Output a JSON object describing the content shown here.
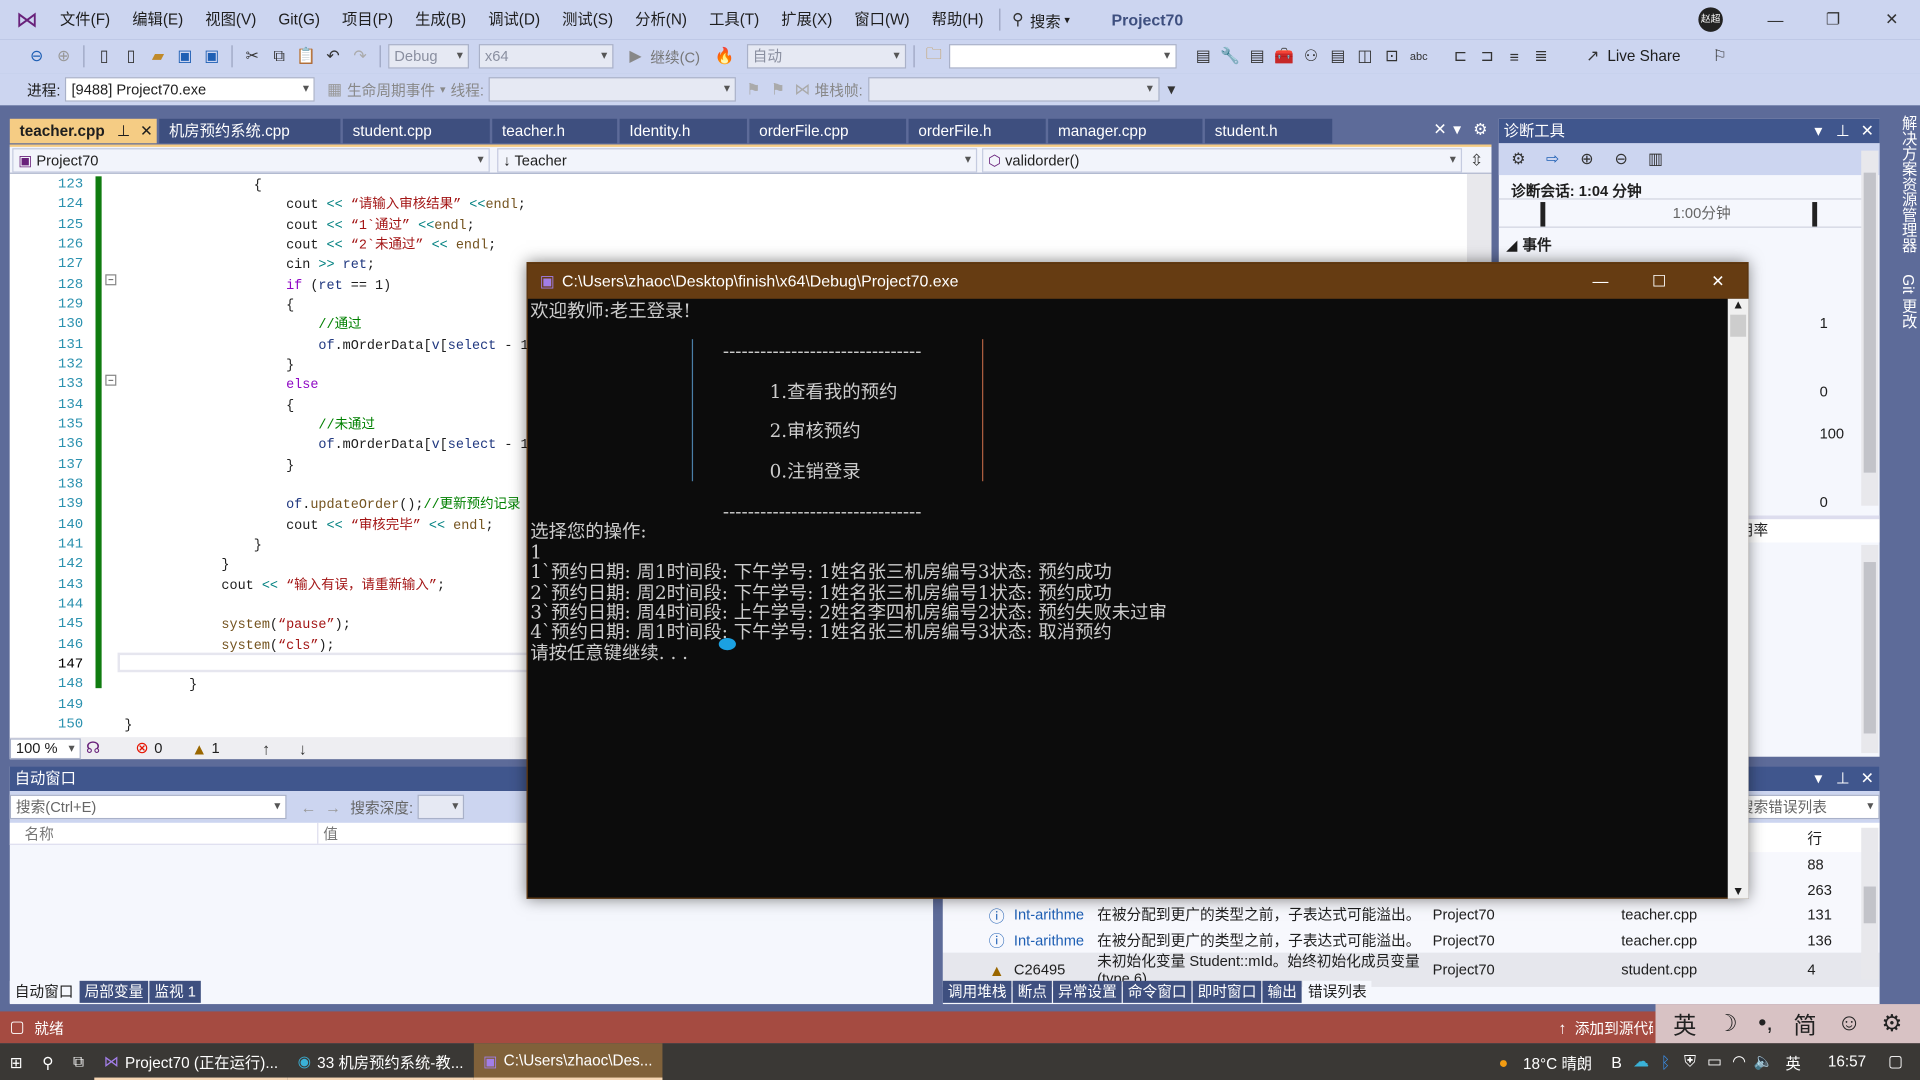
{
  "menubar": {
    "items": [
      "文件(F)",
      "编辑(E)",
      "视图(V)",
      "Git(G)",
      "项目(P)",
      "生成(B)",
      "调试(D)",
      "测试(S)",
      "分析(N)",
      "工具(T)",
      "扩展(X)",
      "窗口(W)",
      "帮助(H)"
    ],
    "search": "搜索",
    "project_title": "Project70",
    "avatar": "赵超"
  },
  "toolbar": {
    "config": "Debug",
    "platform": "x64",
    "continue": "继续(C)",
    "auto": "自动",
    "live_share": "Live Share"
  },
  "debugbar": {
    "process_label": "进程:",
    "process": "[9488] Project70.exe",
    "lifecycle": "生命周期事件",
    "thread_label": "线程:",
    "stack_label": "堆栈帧:"
  },
  "tabs": [
    "teacher.cpp",
    "机房预约系统.cpp",
    "student.cpp",
    "teacher.h",
    "Identity.h",
    "orderFile.cpp",
    "orderFile.h",
    "manager.cpp",
    "student.h"
  ],
  "nav": {
    "project": "Project70",
    "class": "Teacher",
    "member": "validorder()"
  },
  "code": [
    {
      "n": "123",
      "t": [
        [
          "                 {",
          "pl"
        ]
      ]
    },
    {
      "n": "124",
      "t": [
        [
          "                     cout ",
          "pl"
        ],
        [
          "<<",
          "op"
        ],
        [
          " “请输入审核结果” ",
          "str"
        ],
        [
          "<<",
          "op"
        ],
        [
          "endl",
          "fn"
        ],
        [
          ";",
          "pl"
        ]
      ]
    },
    {
      "n": "125",
      "t": [
        [
          "                     cout ",
          "pl"
        ],
        [
          "<<",
          "op"
        ],
        [
          " “1`通过” ",
          "str"
        ],
        [
          "<<",
          "op"
        ],
        [
          "endl",
          "fn"
        ],
        [
          ";",
          "pl"
        ]
      ]
    },
    {
      "n": "126",
      "t": [
        [
          "                     cout ",
          "pl"
        ],
        [
          "<<",
          "op"
        ],
        [
          " “2`未通过” ",
          "str"
        ],
        [
          "<<",
          "op"
        ],
        [
          " endl",
          "fn"
        ],
        [
          ";",
          "pl"
        ]
      ]
    },
    {
      "n": "127",
      "t": [
        [
          "                     cin ",
          "pl"
        ],
        [
          ">>",
          "op"
        ],
        [
          " ret",
          "id"
        ],
        [
          ";",
          "pl"
        ]
      ]
    },
    {
      "n": "128",
      "t": [
        [
          "                     ",
          "pl"
        ],
        [
          "if",
          "kw"
        ],
        [
          " (",
          "pl"
        ],
        [
          "ret",
          "id"
        ],
        [
          " == 1)",
          "pl"
        ]
      ]
    },
    {
      "n": "129",
      "t": [
        [
          "                     {",
          "pl"
        ]
      ]
    },
    {
      "n": "130",
      "t": [
        [
          "                         //通过",
          "cm"
        ]
      ]
    },
    {
      "n": "131",
      "t": [
        [
          "                         ",
          "pl"
        ],
        [
          "of",
          "id"
        ],
        [
          ".mOrderData[",
          "pl"
        ],
        [
          "v",
          "id"
        ],
        [
          "[",
          "pl"
        ],
        [
          "select",
          "id"
        ],
        [
          " - 1]][\"s",
          "pl"
        ]
      ]
    },
    {
      "n": "132",
      "t": [
        [
          "                     }",
          "pl"
        ]
      ]
    },
    {
      "n": "133",
      "t": [
        [
          "                     ",
          "pl"
        ],
        [
          "else",
          "kw"
        ]
      ]
    },
    {
      "n": "134",
      "t": [
        [
          "                     {",
          "pl"
        ]
      ]
    },
    {
      "n": "135",
      "t": [
        [
          "                         //未通过",
          "cm"
        ]
      ]
    },
    {
      "n": "136",
      "t": [
        [
          "                         ",
          "pl"
        ],
        [
          "of",
          "id"
        ],
        [
          ".mOrderData[",
          "pl"
        ],
        [
          "v",
          "id"
        ],
        [
          "[",
          "pl"
        ],
        [
          "select",
          "id"
        ],
        [
          " - 1]][\"s",
          "pl"
        ]
      ]
    },
    {
      "n": "137",
      "t": [
        [
          "                     }",
          "pl"
        ]
      ]
    },
    {
      "n": "138",
      "t": [
        [
          "",
          "pl"
        ]
      ]
    },
    {
      "n": "139",
      "t": [
        [
          "                     ",
          "pl"
        ],
        [
          "of",
          "id"
        ],
        [
          ".",
          "pl"
        ],
        [
          "updateOrder",
          "fn"
        ],
        [
          "();",
          "pl"
        ],
        [
          "//更新预约记录",
          "cm"
        ]
      ]
    },
    {
      "n": "140",
      "t": [
        [
          "                     cout ",
          "pl"
        ],
        [
          "<<",
          "op"
        ],
        [
          " “审核完毕” ",
          "str"
        ],
        [
          "<<",
          "op"
        ],
        [
          " endl",
          "fn"
        ],
        [
          ";",
          "pl"
        ]
      ]
    },
    {
      "n": "141",
      "t": [
        [
          "                 }",
          "pl"
        ]
      ]
    },
    {
      "n": "142",
      "t": [
        [
          "             }",
          "pl"
        ]
      ]
    },
    {
      "n": "143",
      "t": [
        [
          "             cout ",
          "pl"
        ],
        [
          "<<",
          "op"
        ],
        [
          " “输入有误，请重新输入”",
          "str"
        ],
        [
          ";",
          "pl"
        ]
      ]
    },
    {
      "n": "144",
      "t": [
        [
          "",
          "pl"
        ]
      ]
    },
    {
      "n": "145",
      "t": [
        [
          "             ",
          "pl"
        ],
        [
          "system",
          "fn"
        ],
        [
          "(",
          "pl"
        ],
        [
          "“pause”",
          "str"
        ],
        [
          ");",
          "pl"
        ]
      ]
    },
    {
      "n": "146",
      "t": [
        [
          "             ",
          "pl"
        ],
        [
          "system",
          "fn"
        ],
        [
          "(",
          "pl"
        ],
        [
          "“cls”",
          "str"
        ],
        [
          ");",
          "pl"
        ]
      ]
    },
    {
      "n": "147",
      "t": [
        [
          "",
          "pl"
        ]
      ]
    },
    {
      "n": "148",
      "t": [
        [
          "         }",
          "pl"
        ]
      ]
    },
    {
      "n": "149",
      "t": [
        [
          "",
          "pl"
        ]
      ]
    },
    {
      "n": "150",
      "t": [
        [
          " }",
          "pl"
        ]
      ]
    }
  ],
  "editor_status": {
    "zoom": "100 %",
    "errors": "0",
    "warnings": "1"
  },
  "diag": {
    "title": "诊断工具",
    "session": "诊断会话: 1:04 分钟",
    "timeline": "1:00分钟",
    "events": "事件",
    "axis": [
      "1",
      "0",
      "100",
      "0"
    ],
    "rate": "用率"
  },
  "right_strip": [
    "解决方案资源管理器",
    "Git 更改"
  ],
  "autos": {
    "title": "自动窗口",
    "search_placeholder": "搜索(Ctrl+E)",
    "depth_label": "搜索深度:",
    "col_name": "名称",
    "col_value": "值",
    "tabs": [
      "自动窗口",
      "局部变量",
      "监视 1"
    ]
  },
  "errors": {
    "search_placeholder": "搜索错误列表",
    "col_line": "行",
    "rows": [
      {
        "icon": "none",
        "code": "",
        "desc": "",
        "project": "",
        "file": "",
        "line": "88"
      },
      {
        "icon": "none",
        "code": "",
        "desc": "",
        "project": "",
        "file": "",
        "line": "263"
      },
      {
        "icon": "info",
        "code": "Int-arithme",
        "desc": "在被分配到更广的类型之前，子表达式可能溢出。",
        "project": "Project70",
        "file": "teacher.cpp",
        "line": "131"
      },
      {
        "icon": "info",
        "code": "Int-arithme",
        "desc": "在被分配到更广的类型之前，子表达式可能溢出。",
        "project": "Project70",
        "file": "teacher.cpp",
        "line": "136"
      },
      {
        "icon": "warning",
        "code": "C26495",
        "desc": "未初始化变量 Student::mId。始终初始化成员变量(type.6)",
        "project": "Project70",
        "file": "student.cpp",
        "line": "4"
      }
    ],
    "tabs": [
      "调用堆栈",
      "断点",
      "异常设置",
      "命令窗口",
      "即时窗口",
      "输出",
      "错误列表"
    ]
  },
  "status": {
    "ready": "就绪",
    "source_control": "添加到源代码管理"
  },
  "ime": [
    "英",
    "☽",
    "•,",
    "简",
    "☺",
    "⚙"
  ],
  "taskbar": {
    "items": [
      "Project70 (正在运行)...",
      "33 机房预约系统-教...",
      "C:\\Users\\zhaoc\\Des..."
    ],
    "weather": "18°C  晴朗",
    "lang": "英",
    "time": "16:57"
  },
  "console": {
    "title": "C:\\Users\\zhaoc\\Desktop\\finish\\x64\\Debug\\Project70.exe",
    "lines": [
      "欢迎教师:老王登录!",
      "",
      "                                 --------------------------------",
      "",
      "                                         1.查看我的预约",
      "",
      "                                         2.审核预约",
      "",
      "                                         0.注销登录",
      "",
      "                                 --------------------------------",
      "选择您的操作:",
      "1",
      "1`预约日期: 周1时间段: 下午学号: 1姓名张三机房编号3状态: 预约成功",
      "2`预约日期: 周2时间段: 下午学号: 1姓名张三机房编号1状态: 预约成功",
      "3`预约日期: 周4时间段: 上午学号: 2姓名李四机房编号2状态: 预约失败未过审",
      "4`预约日期: 周1时间段: 下午学号: 1姓名张三机房编号3状态: 取消预约",
      "请按任意键继续. . ."
    ]
  },
  "colors": {
    "accent": "#f5cc84",
    "dock": "#5d6b99",
    "status_debug": "#a54b41",
    "console_title": "#663c12"
  }
}
